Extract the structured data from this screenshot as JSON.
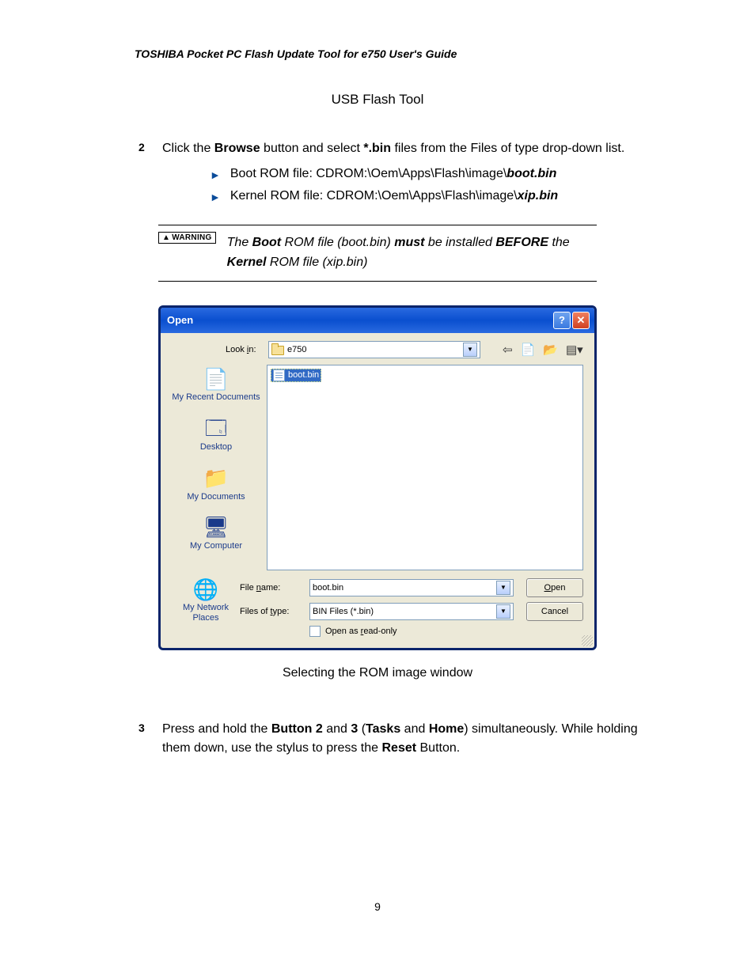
{
  "doc_header": "TOSHIBA Pocket PC Flash Update Tool for e750 User's Guide",
  "section_title": "USB Flash Tool",
  "step2": {
    "num": "2",
    "text_parts": {
      "a": "Click the ",
      "b_bold": "Browse",
      "c": " button and select ",
      "d_bold": "*.bin",
      "e": " files from the Files of type drop-down list."
    },
    "bullets": [
      {
        "pre": "Boot ROM file: CDROM:\\Oem\\Apps\\Flash\\image\\",
        "bolditalic": "boot.bin"
      },
      {
        "pre": "Kernel ROM file: CDROM:\\Oem\\Apps\\Flash\\image\\",
        "bolditalic": "xip.bin"
      }
    ]
  },
  "warning": {
    "badge": "WARNING",
    "parts": {
      "a": "The ",
      "b_bold": "Boot",
      "c": " ROM file (boot.bin) ",
      "d_bold": "must",
      "e": " be installed ",
      "f_bold": "BEFORE",
      "g": " the ",
      "h_bold": "Kernel",
      "i": " ROM file (xip.bin)"
    }
  },
  "dialog": {
    "title": "Open",
    "lookin_label": "Look in:",
    "lookin_value": "e750",
    "places": [
      "My Recent Documents",
      "Desktop",
      "My Documents",
      "My Computer",
      "My Network Places"
    ],
    "file_listed": "boot.bin",
    "filename_label": "File name:",
    "filename_value": "boot.bin",
    "filetype_label": "Files of type:",
    "filetype_value": "BIN Files (*.bin)",
    "readonly_label": "Open as read-only",
    "open_btn": "Open",
    "cancel_btn": "Cancel"
  },
  "caption": "Selecting the ROM image window",
  "step3": {
    "num": "3",
    "parts": {
      "a": "Press and hold the ",
      "b_bold": "Button 2",
      "c": " and ",
      "d_bold": "3",
      "e": " (",
      "f_bold": "Tasks",
      "g": " and ",
      "h_bold": "Home",
      "i": ") simultaneously. While holding them down, use the stylus to press the ",
      "j_bold": "Reset",
      "k": " Button."
    }
  },
  "page_number": "9"
}
